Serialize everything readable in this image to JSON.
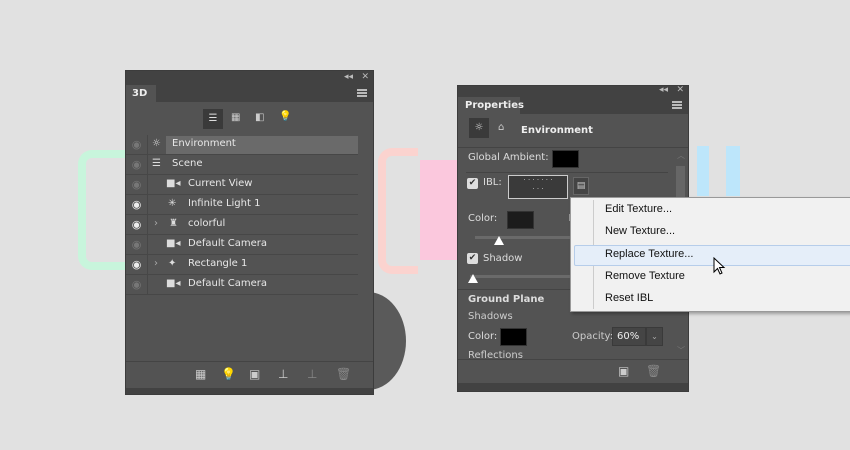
{
  "panel3d": {
    "tab": "3D",
    "collapse": "◂◂",
    "close": "✕",
    "filters": [
      "scene-filter",
      "mesh-filter",
      "material-filter",
      "light-filter"
    ],
    "items": [
      {
        "label": "Environment",
        "visible": false,
        "selected": true,
        "icon": "environment-icon",
        "indent": 0
      },
      {
        "label": "Scene",
        "visible": false,
        "icon": "scene-icon",
        "indent": 0
      },
      {
        "label": "Current View",
        "visible": false,
        "icon": "camera-icon",
        "indent": 1
      },
      {
        "label": "Infinite Light 1",
        "visible": true,
        "icon": "light-icon",
        "indent": 1
      },
      {
        "label": "colorful",
        "visible": true,
        "icon": "mesh-icon",
        "indent": 1,
        "expandable": true
      },
      {
        "label": "Default Camera",
        "visible": false,
        "icon": "camera-icon",
        "indent": 1
      },
      {
        "label": "Rectangle 1",
        "visible": true,
        "icon": "mesh-icon",
        "indent": 1,
        "expandable": true
      },
      {
        "label": "Default Camera",
        "visible": false,
        "icon": "camera-icon",
        "indent": 1
      }
    ]
  },
  "properties": {
    "tab": "Properties",
    "collapse": "◂◂",
    "close": "✕",
    "title": "Environment",
    "global_ambient_label": "Global Ambient:",
    "ibl_label": "IBL:",
    "ibl_checked": true,
    "color_label": "Color:",
    "intensity_partial": "I",
    "shadow_label": "Shadow",
    "shadow_checked": true,
    "ground_plane": "Ground Plane",
    "shadows": "Shadows",
    "gp_color_label": "Color:",
    "opacity_label": "Opacity:",
    "opacity_value": "60%",
    "reflections": "Reflections"
  },
  "context_menu": {
    "items": [
      "Edit Texture...",
      "New Texture...",
      "Replace Texture...",
      "Remove Texture",
      "Reset IBL"
    ],
    "highlighted": "Replace Texture..."
  }
}
